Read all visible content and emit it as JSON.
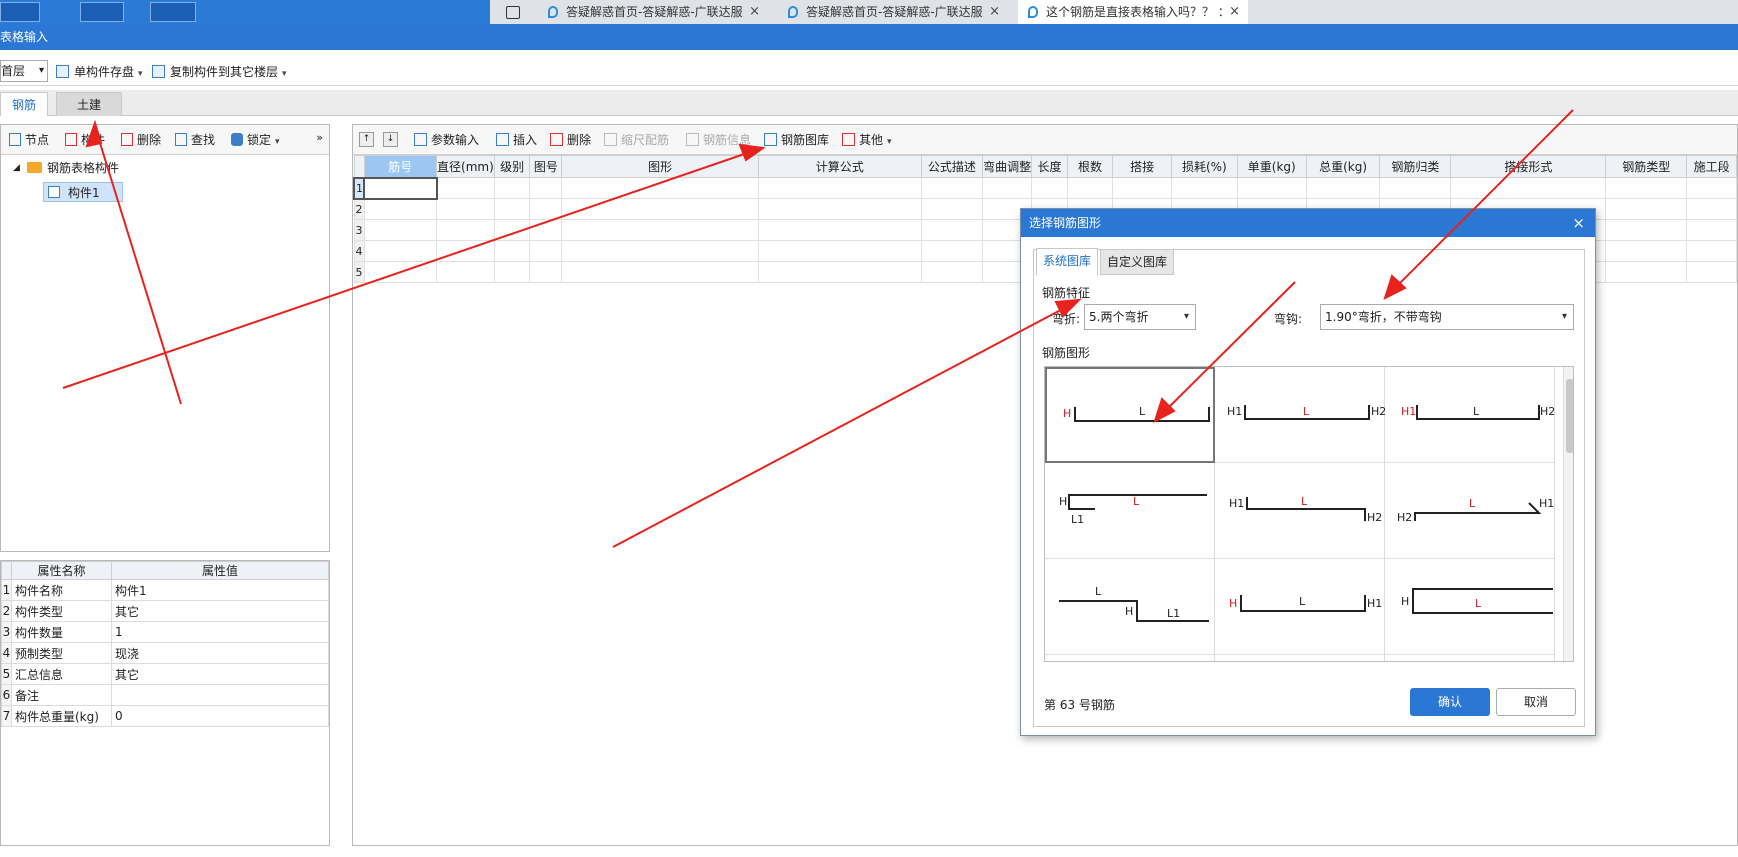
{
  "browser": {
    "tabs": [
      {
        "label": "答疑解惑首页-答疑解惑-广联达服"
      },
      {
        "label": "答疑解惑首页-答疑解惑-广联达服"
      },
      {
        "label": "这个钢筋是直接表格输入吗？？ ："
      }
    ],
    "close_glyph": "×",
    "new_tab_glyph": "+"
  },
  "app": {
    "title": "表格输入"
  },
  "toolbar": {
    "floor": "首层",
    "save_component": "单构件存盘",
    "copy_to_floors": "复制构件到其它楼层"
  },
  "module_tabs": [
    "钢筋",
    "土建"
  ],
  "left_toolbar": {
    "node": "节点",
    "component": "构件",
    "delete": "删除",
    "find": "查找",
    "lock": "锁定",
    "more": "»"
  },
  "tree": {
    "root": "钢筋表格构件",
    "child": "构件1"
  },
  "properties": {
    "headers": [
      "属性名称",
      "属性值"
    ],
    "rows": [
      {
        "idx": "1",
        "name": "构件名称",
        "value": "构件1"
      },
      {
        "idx": "2",
        "name": "构件类型",
        "value": "其它"
      },
      {
        "idx": "3",
        "name": "构件数量",
        "value": "1"
      },
      {
        "idx": "4",
        "name": "预制类型",
        "value": "现浇"
      },
      {
        "idx": "5",
        "name": "汇总信息",
        "value": "其它"
      },
      {
        "idx": "6",
        "name": "备注",
        "value": ""
      },
      {
        "idx": "7",
        "name": "构件总重量(kg)",
        "value": "0"
      }
    ]
  },
  "main_toolbar": {
    "param_input": "参数输入",
    "insert": "插入",
    "delete": "删除",
    "scale_rebar": "缩尺配筋",
    "rebar_info": "钢筋信息",
    "rebar_library": "钢筋图库",
    "other": "其他"
  },
  "grid": {
    "headers": [
      "筋号",
      "直径(mm)",
      "级别",
      "图号",
      "图形",
      "计算公式",
      "公式描述",
      "弯曲调整",
      "长度",
      "根数",
      "搭接",
      "损耗(%)",
      "单重(kg)",
      "总重(kg)",
      "钢筋归类",
      "搭接形式",
      "钢筋类型",
      "施工段"
    ],
    "row_numbers": [
      "1",
      "2",
      "3",
      "4",
      "5"
    ]
  },
  "dialog": {
    "title": "选择钢筋图形",
    "close": "×",
    "tabs": [
      "系统图库",
      "自定义图库"
    ],
    "feature_section": "钢筋特征",
    "bend_label": "弯折:",
    "bend_value": "5.两个弯折",
    "hook_label": "弯钩:",
    "hook_value": "1.90°弯折，不带弯钩",
    "shape_section": "钢筋图形",
    "status": "第 63 号钢筋",
    "ok": "确认",
    "cancel": "取消",
    "shape_labels": {
      "L": "L",
      "H": "H",
      "H1": "H1",
      "H2": "H2",
      "L1": "L1"
    }
  },
  "colors": {
    "accent": "#2b78d4",
    "annotation_arrow": "#e8221c",
    "shape_label_red": "#d11a1a"
  }
}
